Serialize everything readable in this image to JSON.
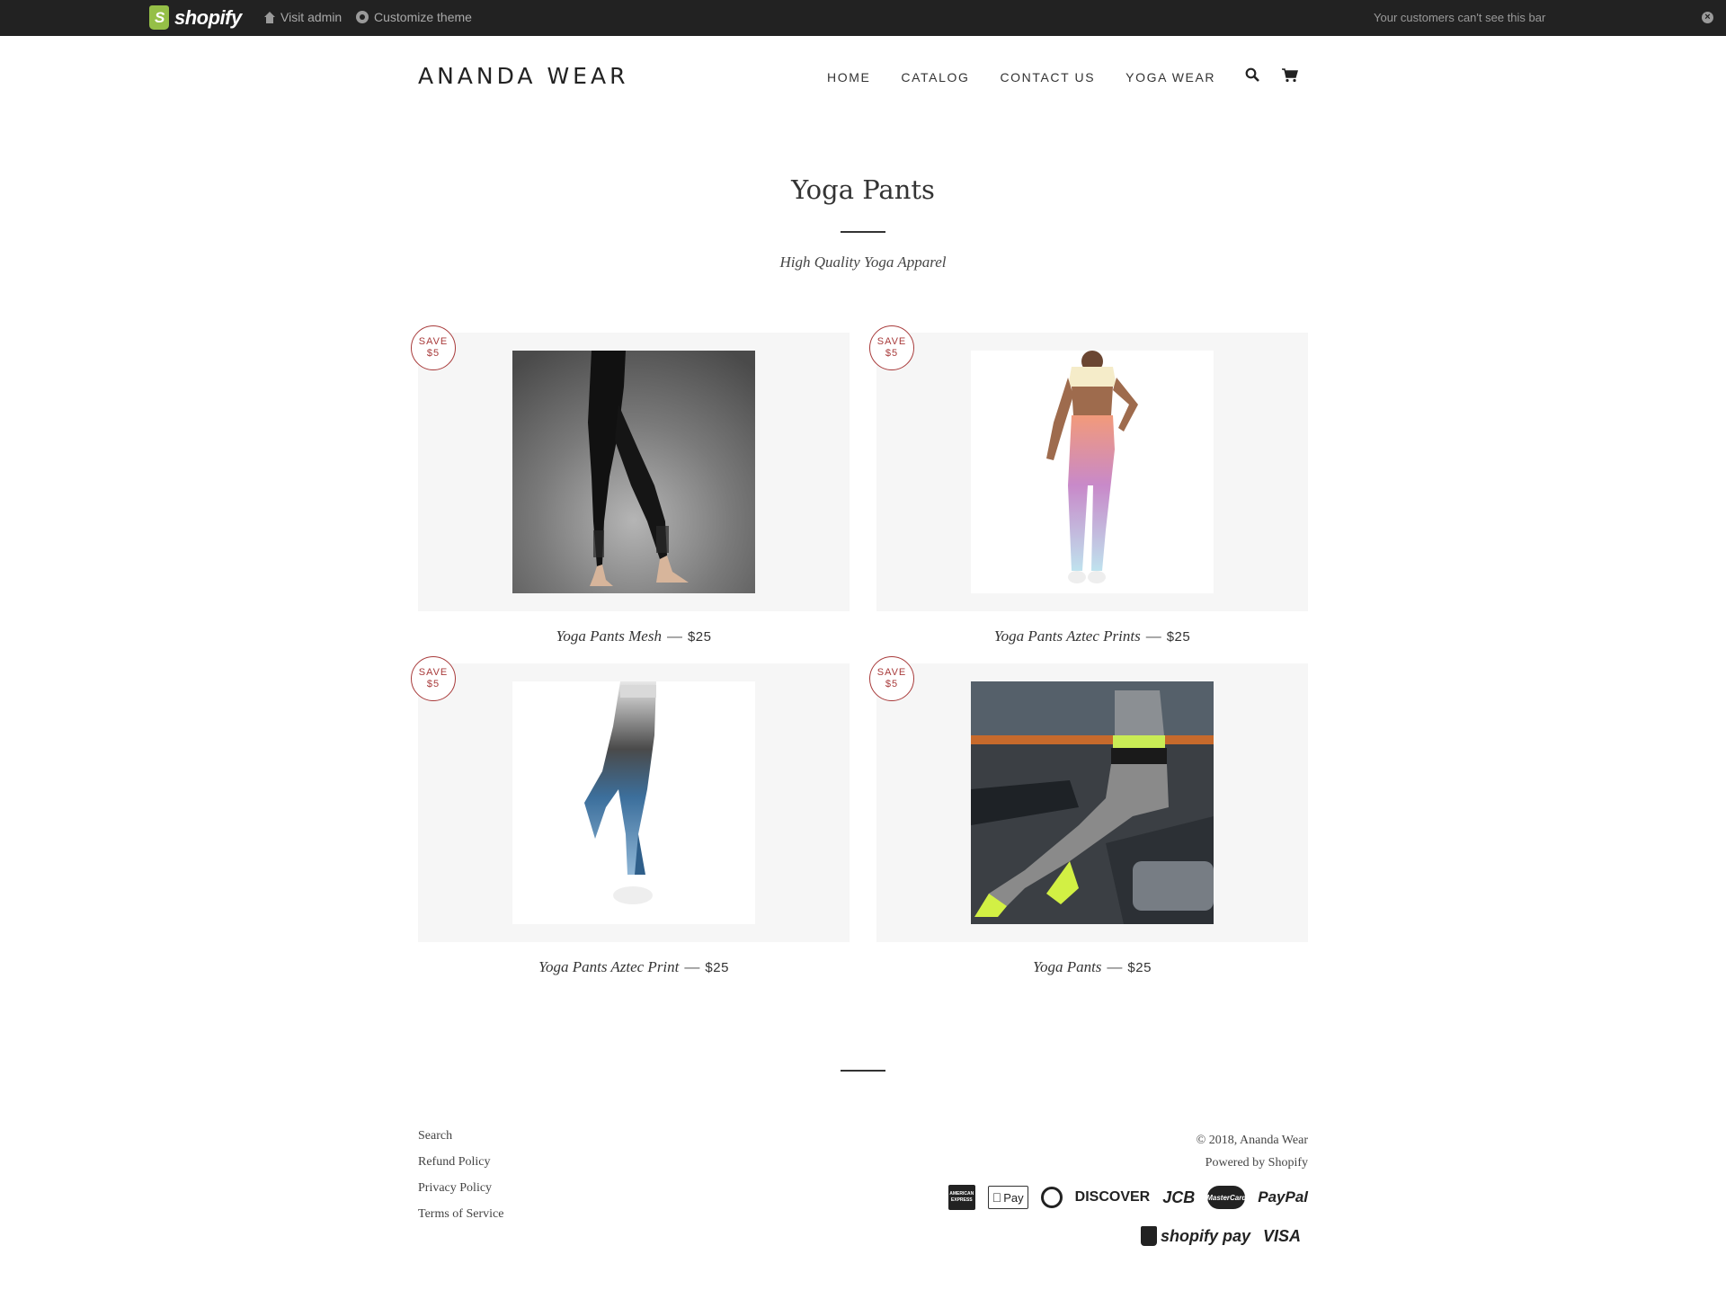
{
  "admin_bar": {
    "logo_text": "shopify",
    "visit_admin": "Visit admin",
    "customize_theme": "Customize theme",
    "note": "Your customers can't see this bar",
    "close_icon": "close-icon"
  },
  "header": {
    "brand": "ANANDA WEAR",
    "nav": [
      "HOME",
      "CATALOG",
      "CONTACT US",
      "YOGA WEAR"
    ],
    "search_icon": "search-icon",
    "cart_icon": "cart-icon"
  },
  "collection": {
    "title": "Yoga Pants",
    "subtitle": "High Quality Yoga Apparel"
  },
  "products": [
    {
      "name": "Yoga Pants Mesh",
      "separator": "—",
      "price": "$25",
      "badge_line1": "SAVE",
      "badge_line2": "$5"
    },
    {
      "name": "Yoga Pants Aztec Prints",
      "separator": "—",
      "price": "$25",
      "badge_line1": "SAVE",
      "badge_line2": "$5"
    },
    {
      "name": "Yoga Pants Aztec Print",
      "separator": "—",
      "price": "$25",
      "badge_line1": "SAVE",
      "badge_line2": "$5"
    },
    {
      "name": "Yoga Pants",
      "separator": "—",
      "price": "$25",
      "badge_line1": "SAVE",
      "badge_line2": "$5"
    }
  ],
  "footer": {
    "links": [
      "Search",
      "Refund Policy",
      "Privacy Policy",
      "Terms of Service"
    ],
    "copyright": "© 2018, Ananda Wear",
    "powered": "Powered by Shopify",
    "payments_row1": [
      "AMERICAN EXPRESS",
      "Pay",
      "DISCOVER",
      "JCB",
      "MasterCard",
      "PayPal"
    ],
    "payments_row2": [
      "shopify pay",
      "VISA"
    ]
  },
  "colors": {
    "admin_bar_bg": "#222222",
    "shopify_green": "#95bf47",
    "badge": "#a83a3a",
    "card_bg": "#f6f6f6"
  }
}
